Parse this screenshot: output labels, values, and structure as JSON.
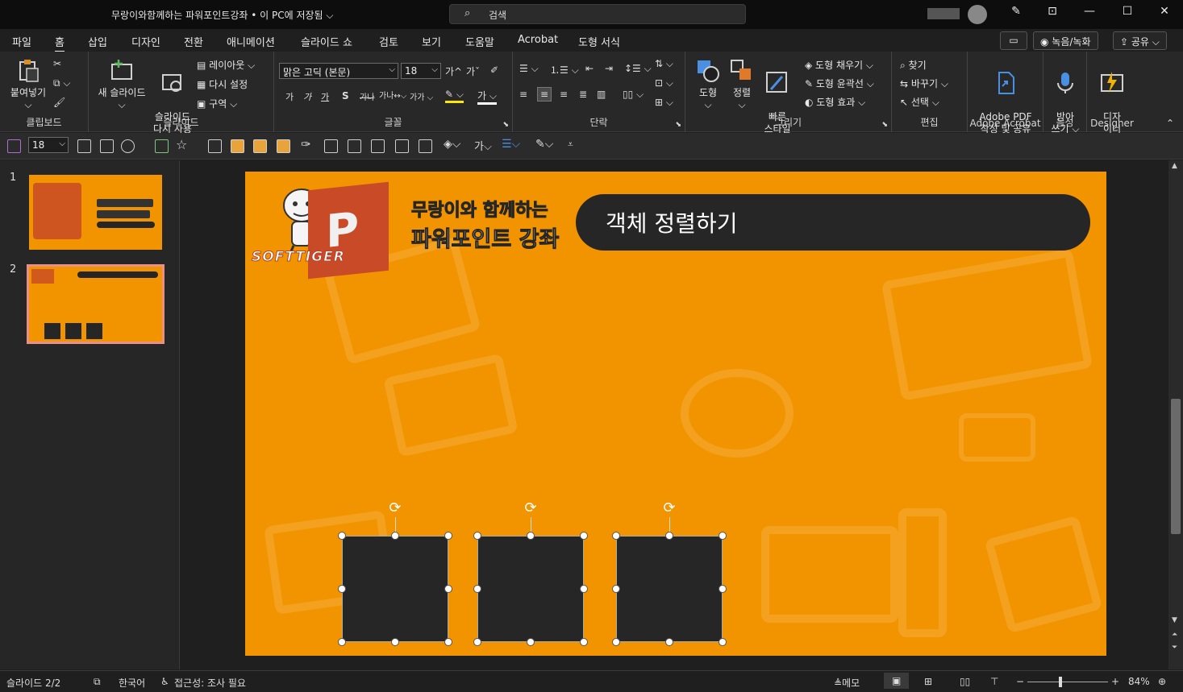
{
  "titlebar": {
    "title": "무랑이와함께하는 파워포인트강좌 • 이 PC에 저장됨 ⌵",
    "search_placeholder": "검색"
  },
  "menu": {
    "tabs": [
      "파일",
      "홈",
      "삽입",
      "디자인",
      "전환",
      "애니메이션",
      "슬라이드 쇼",
      "검토",
      "보기",
      "도움말",
      "Acrobat",
      "도형 서식"
    ],
    "active": "홈",
    "record_label": "녹음/녹화",
    "share_label": "공유"
  },
  "ribbon": {
    "clipboard": {
      "paste": "붙여넣기",
      "group": "클립보드"
    },
    "slides": {
      "new_slide": "새 슬라이드",
      "reuse": "슬라이드\n다시 사용",
      "layout": "레이아웃",
      "reset": "다시 설정",
      "section": "구역",
      "group": "슬라이드"
    },
    "font": {
      "name": "맑은 고딕 (본문)",
      "size": "18",
      "group": "글꼴"
    },
    "paragraph": {
      "group": "단락"
    },
    "drawing": {
      "shape": "도형",
      "arrange": "정렬",
      "quick_style": "빠른\n스타일",
      "fill": "도형 채우기",
      "outline": "도형 윤곽선",
      "effects": "도형 효과",
      "group": "그리기"
    },
    "editing": {
      "find": "찾기",
      "replace": "바꾸기",
      "select": "선택",
      "group": "편집"
    },
    "acrobat": {
      "create": "Adobe PDF\n작성 및 공유",
      "group": "Adobe Acrobat"
    },
    "voice": {
      "dictate": "받아\n쓰기",
      "group": "음성"
    },
    "designer": {
      "label": "디자\n이너",
      "group": "Designer"
    }
  },
  "qat": {
    "font_size": "18"
  },
  "thumbnails": {
    "numbers": [
      "1",
      "2"
    ],
    "selected": 2
  },
  "slide": {
    "header_title": "객체 정렬하기",
    "logo_line1": "무랑이와 함께하는",
    "logo_line2": "파워포인트 강좌",
    "logo_brand": "SOFTTIGER"
  },
  "status": {
    "slide_info": "슬라이드 2/2",
    "language": "한국어",
    "accessibility": "접근성: 조사 필요",
    "notes": "메모",
    "zoom": "84%"
  },
  "colors": {
    "slide_bg": "#f19400",
    "box_fill": "#262626",
    "accent": "#d24726"
  }
}
